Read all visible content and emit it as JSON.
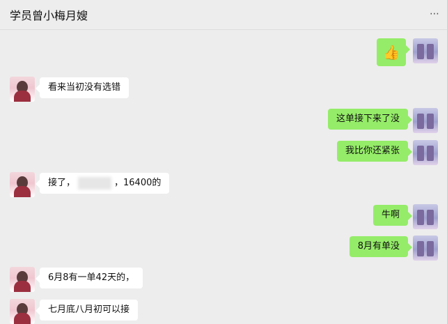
{
  "header": {
    "title": "学员曾小梅月嫂",
    "more_icon": "⋯"
  },
  "messages": [
    {
      "side": "right",
      "type": "emoji",
      "icon": "thumbs-up-icon",
      "text": "👍"
    },
    {
      "side": "left",
      "text": "看来当初没有选错"
    },
    {
      "side": "right",
      "text": "这单接下来了没"
    },
    {
      "side": "right",
      "text": "我比你还紧张"
    },
    {
      "side": "left",
      "prefix": "接了，",
      "suffix": "，16400的"
    },
    {
      "side": "right",
      "text": "牛啊"
    },
    {
      "side": "right",
      "text": "8月有单没"
    },
    {
      "side": "left",
      "text": "6月8有一单42天的，"
    },
    {
      "side": "left",
      "text": "七月底八月初可以接"
    }
  ],
  "colors": {
    "background": "#ededed",
    "bubble_right": "#95ec69",
    "bubble_left": "#ffffff"
  }
}
